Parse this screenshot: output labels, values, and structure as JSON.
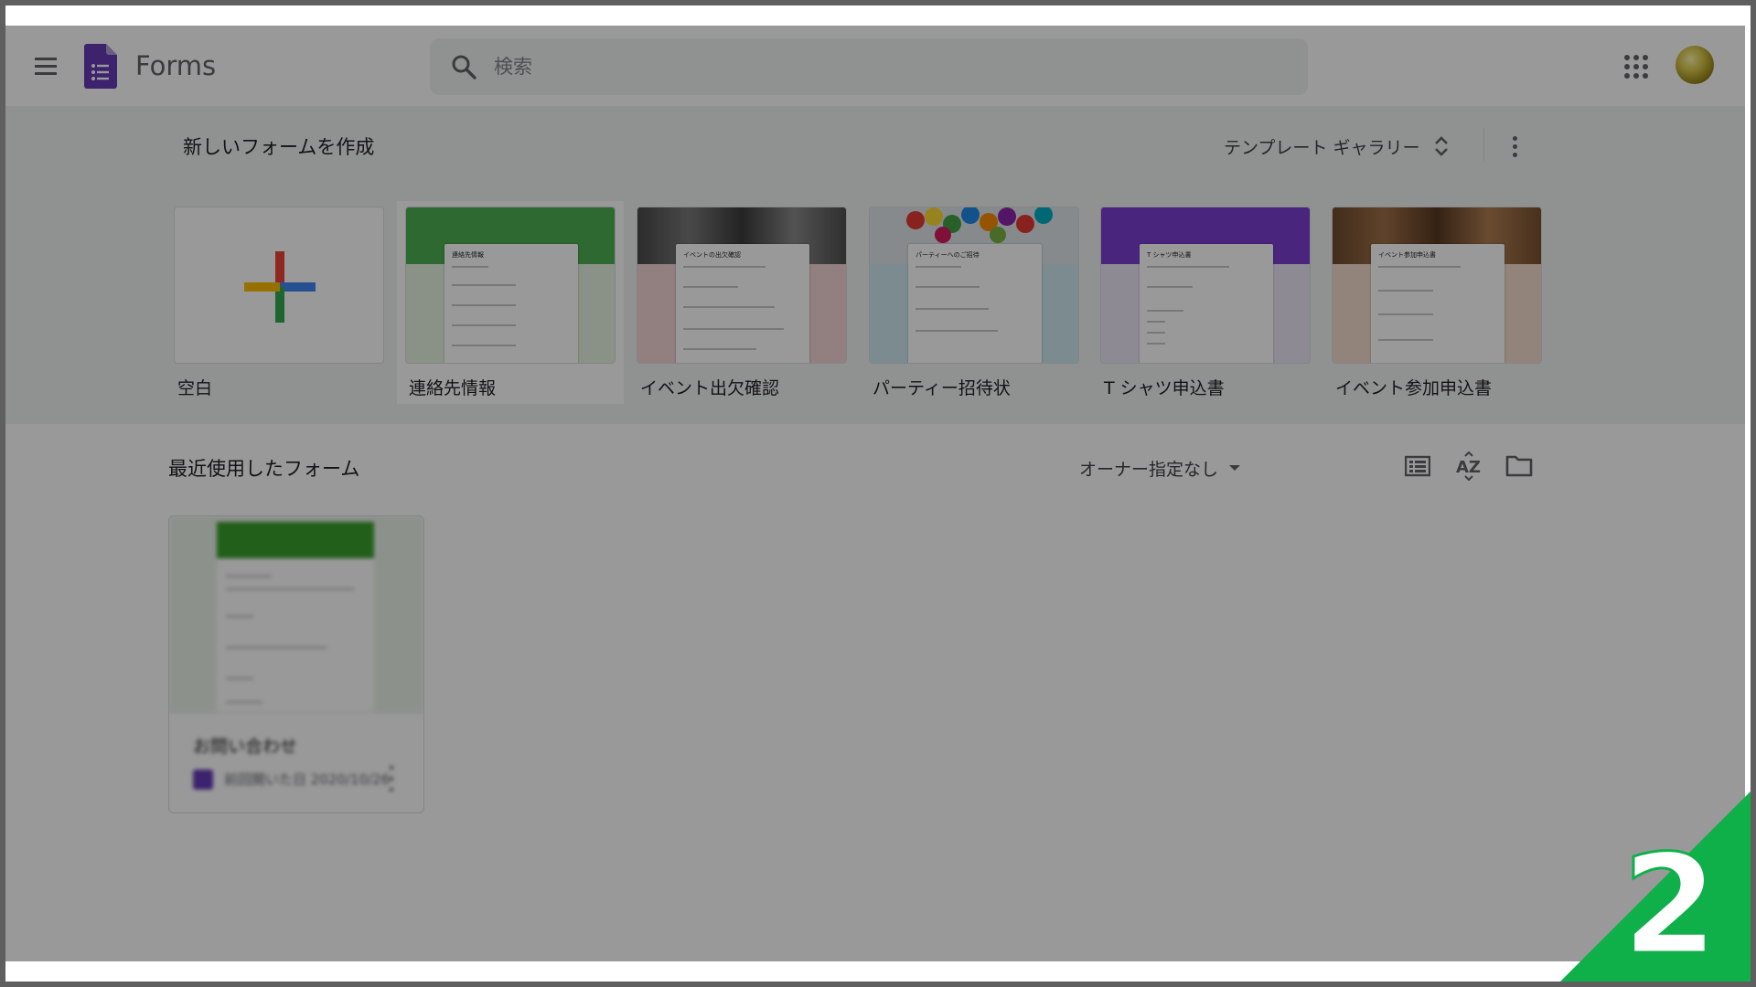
{
  "header": {
    "app_title": "Forms",
    "search_placeholder": "検索"
  },
  "templates": {
    "section_title": "新しいフォームを作成",
    "gallery_label": "テンプレート ギャラリー",
    "items": [
      {
        "label": "空白"
      },
      {
        "label": "連絡先情報",
        "form_title": "連絡先情報"
      },
      {
        "label": "イベント出欠確認",
        "form_title": "イベントの出欠確認"
      },
      {
        "label": "パーティー招待状",
        "form_title": "パーティーへのご招待"
      },
      {
        "label": "T シャツ申込書",
        "form_title": "T シャツ申込書"
      },
      {
        "label": "イベント参加申込書",
        "form_title": "イベント参加申込書"
      }
    ]
  },
  "recent": {
    "section_title": "最近使用したフォーム",
    "owner_filter": "オーナー指定なし",
    "sort_label": "AZ",
    "card": {
      "name": "お問い合わせ",
      "meta": "前回開いた日 2020/10/26"
    }
  },
  "step_badge": "2",
  "colors": {
    "forms_purple": "#673ab7",
    "template_green": "#4caf50",
    "badge_green": "#0fb04a"
  }
}
